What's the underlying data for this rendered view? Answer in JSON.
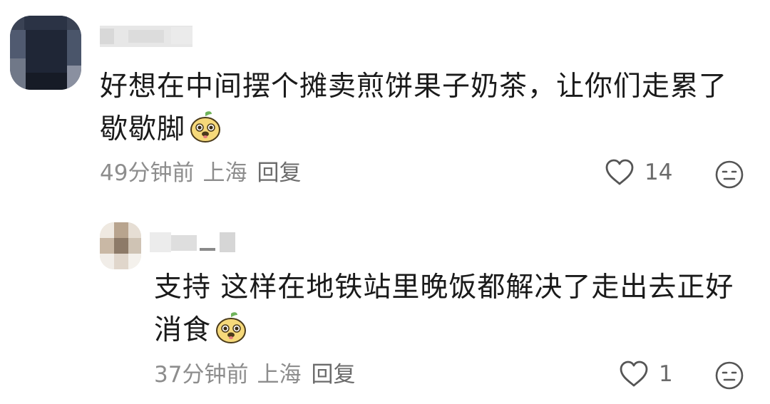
{
  "comments": [
    {
      "text": "好想在中间摆个摊卖煎饼果子奶茶，让你们走累了歇歇脚",
      "emoji": "cute-dog-face-emoji",
      "time": "49分钟前",
      "location": "上海",
      "reply_label": "回复",
      "likes": "14"
    },
    {
      "text": "支持 这样在地铁站里晚饭都解决了走出去正好消食",
      "emoji": "cute-dog-face-emoji",
      "time": "37分钟前",
      "location": "上海",
      "reply_label": "回复",
      "likes": "1"
    }
  ],
  "icons": {
    "like": "heart-outline-icon",
    "dislike": "unhappy-face-icon"
  }
}
